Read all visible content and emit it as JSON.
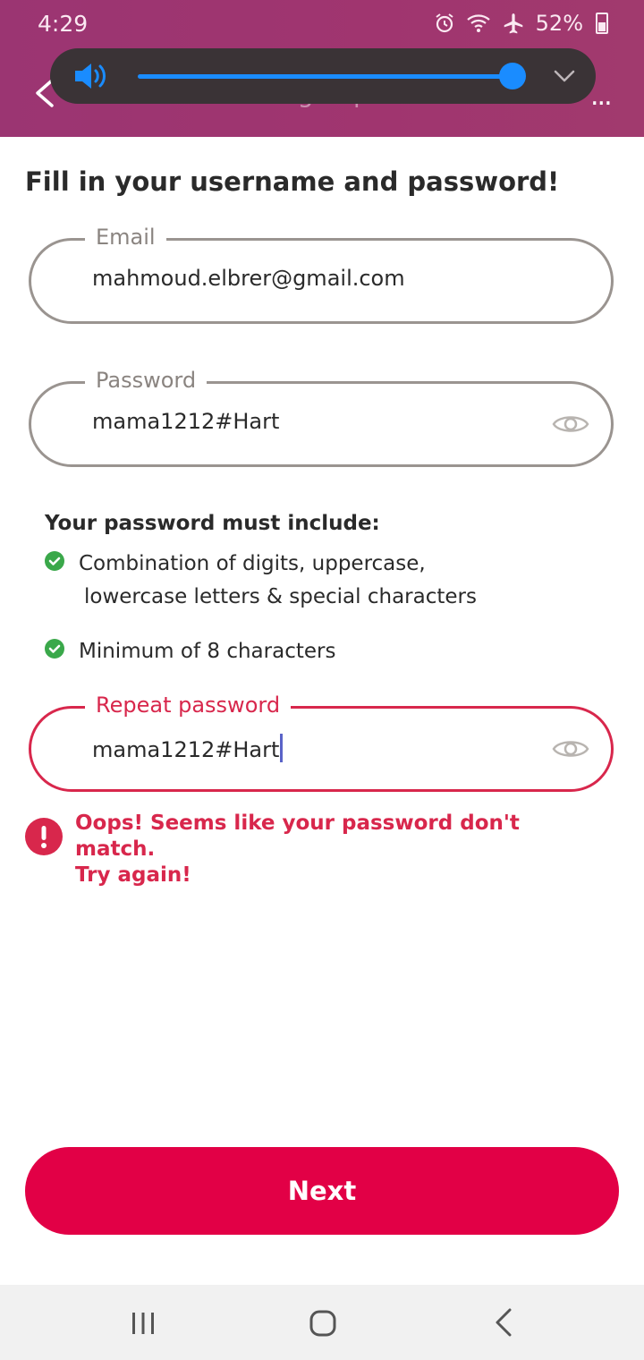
{
  "status_bar": {
    "time": "4:29",
    "battery": "52%"
  },
  "header": {
    "title": "Sign up",
    "more_label": "..."
  },
  "volume": {
    "level": 0.93
  },
  "heading": "Fill in your username and password!",
  "email_field": {
    "label": "Email",
    "value": "mahmoud.elbrer@gmail.com"
  },
  "password_field": {
    "label": "Password",
    "value": "mama1212#Hart"
  },
  "rules": {
    "title": "Your password must include:",
    "items": [
      {
        "line1": "Combination of digits, uppercase,",
        "line2": "lowercase letters & special characters"
      },
      {
        "line1": "Minimum of 8 characters"
      }
    ]
  },
  "repeat_field": {
    "label": "Repeat password",
    "value": "mama1212#Hart"
  },
  "error": {
    "line1": "Oops! Seems like your password don't match.",
    "line2": "Try again!"
  },
  "next_button": "Next",
  "colors": {
    "brand": "#e20046",
    "header": "#9b3572",
    "error": "#d8274c",
    "success": "#3aa84a",
    "volume_accent": "#1a8cff"
  }
}
